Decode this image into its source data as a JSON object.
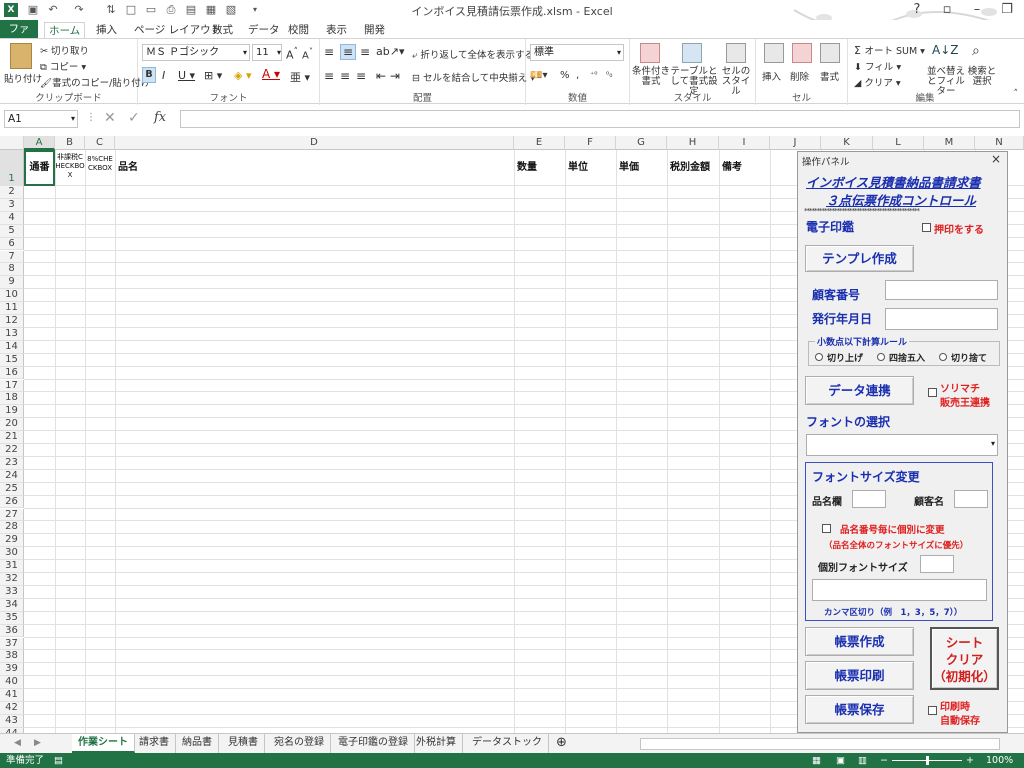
{
  "window": {
    "title": "インボイス見積請伝票作成.xlsm - Excel"
  },
  "ribbon_tabs": [
    "ファイル",
    "ホーム",
    "挿入",
    "ページ レイアウト",
    "数式",
    "データ",
    "校閲",
    "表示",
    "開発"
  ],
  "ribbon": {
    "clipboard": {
      "paste": "貼り付け",
      "cut": "切り取り",
      "copy": "コピー",
      "format_painter": "書式のコピー/貼り付け",
      "label": "クリップボード"
    },
    "font": {
      "name": "ＭＳ Ｐゴシック",
      "size": "11",
      "label": "フォント"
    },
    "alignment": {
      "wrap": "折り返して全体を表示する",
      "merge": "セルを結合して中央揃え",
      "label": "配置"
    },
    "number": {
      "format": "標準",
      "label": "数値"
    },
    "styles": {
      "conditional": "条件付き書式",
      "table": "テーブルとして書式設定",
      "cell": "セルのスタイル",
      "label": "スタイル"
    },
    "cells": {
      "insert": "挿入",
      "delete": "削除",
      "format": "書式",
      "label": "セル"
    },
    "editing": {
      "autosum": "オート SUM",
      "fill": "フィル",
      "clear": "クリア",
      "sort": "並べ替えとフィルター",
      "find": "検索と選択",
      "label": "編集"
    }
  },
  "formula_bar": {
    "name_box": "A1",
    "fx": "fx",
    "formula": ""
  },
  "columns": [
    "A",
    "B",
    "C",
    "D",
    "E",
    "F",
    "G",
    "H",
    "I",
    "J",
    "K",
    "L",
    "M",
    "N"
  ],
  "rows": [
    "1",
    "2",
    "3",
    "4",
    "5",
    "6",
    "7",
    "8",
    "9",
    "10",
    "11",
    "12",
    "13",
    "14",
    "15",
    "16",
    "17",
    "18",
    "19",
    "20",
    "21",
    "22",
    "23",
    "24",
    "25",
    "26",
    "27",
    "28",
    "29",
    "30",
    "31",
    "32",
    "33",
    "34",
    "35",
    "36",
    "37",
    "38",
    "39",
    "40",
    "41",
    "42",
    "43",
    "44"
  ],
  "header_cells": {
    "a1": "通番",
    "b1": "非課税CHECKBOX",
    "c1": "8%CHECKBOX",
    "d1": "品名",
    "e1": "数量",
    "f1": "単位",
    "g1": "単価",
    "h1": "税別金額",
    "i1": "備考"
  },
  "panel": {
    "title": "操作パネル",
    "heading1": "インボイス見積書納品書請求書",
    "heading2": "３点伝票作成コントロール",
    "stars": "**********************************************",
    "stamp_label": "電子印鑑",
    "stamp_check": "押印をする",
    "template_button": "テンプレ作成",
    "customer_no": "顧客番号",
    "issue_date": "発行年月日",
    "rounding_group": "小数点以下計算ルール",
    "round_up": "切り上げ",
    "round_half": "四捨五入",
    "round_down": "切り捨て",
    "data_link_button": "データ連携",
    "data_link_check1": "ソリマチ",
    "data_link_check2": "販売王連携",
    "font_select_label": "フォントの選択",
    "font_size_label": "フォントサイズ変更",
    "item_col_label": "品名欄",
    "customer_label": "顧客名",
    "individual_check": "品名番号毎に個別に変更",
    "individual_note": "（品名全体のフォントサイズに優先）",
    "individual_size": "個別フォントサイズ",
    "comma_note": "カンマ区切り（例　1，3，5，7））",
    "create_button": "帳票作成",
    "print_button": "帳票印刷",
    "save_button": "帳票保存",
    "clear_button1": "シート",
    "clear_button2": "クリア",
    "clear_button3": "（初期化）",
    "autosave1": "印刷時",
    "autosave2": "自動保存"
  },
  "sheet_tabs": [
    "作業シート",
    "請求書",
    "納品書",
    "見積書",
    "宛名の登録",
    "電子印鑑の登録",
    "外税計算",
    "データストック"
  ],
  "status": {
    "ready": "準備完了",
    "zoom": "100%"
  }
}
